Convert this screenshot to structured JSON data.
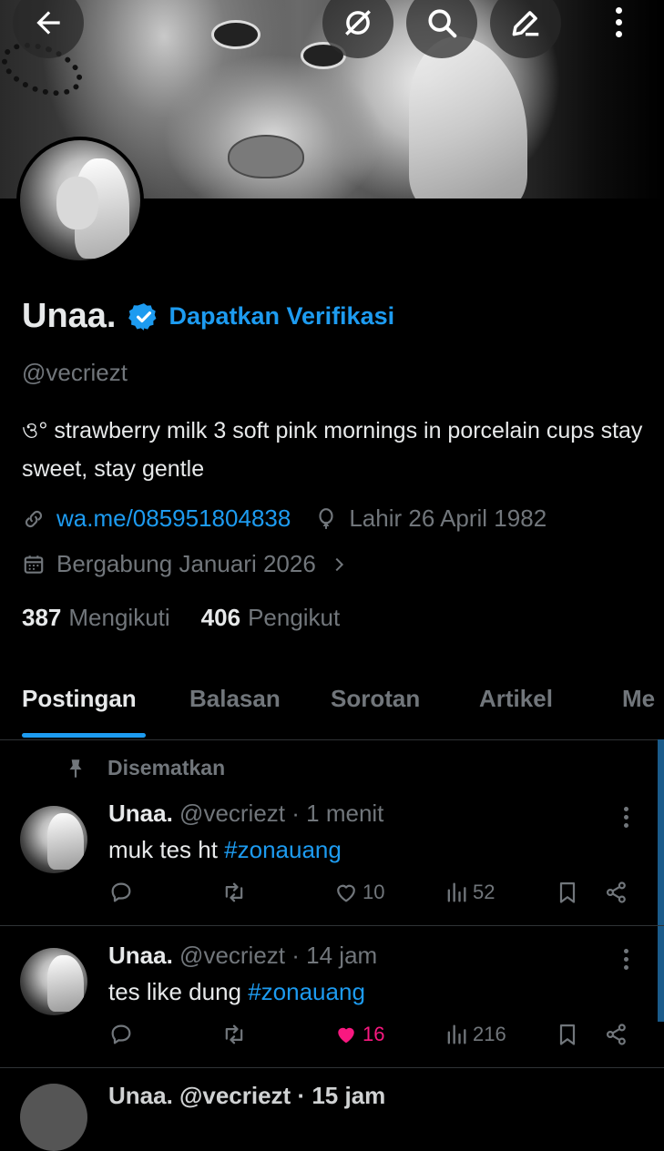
{
  "header": {
    "back_icon": "arrow-left-icon",
    "grok_icon": "grok-icon",
    "search_icon": "search-icon",
    "edit_icon": "edit-icon",
    "more_icon": "more-vertical-icon"
  },
  "profile": {
    "name": "Unaa.",
    "verify_cta": "Dapatkan Verifikasi",
    "handle": "@vecriezt",
    "bio": "ও° strawberry milk 3 soft pink mornings in porcelain cups stay sweet, stay gentle",
    "website": "wa.me/085951804838",
    "birthday": "Lahir 26 April 1982",
    "joined": "Bergabung Januari 2026",
    "following_count": "387",
    "following_label": "Mengikuti",
    "followers_count": "406",
    "followers_label": "Pengikut"
  },
  "tabs": [
    {
      "label": "Postingan",
      "active": true
    },
    {
      "label": "Balasan",
      "active": false
    },
    {
      "label": "Sorotan",
      "active": false
    },
    {
      "label": "Artikel",
      "active": false
    },
    {
      "label": "Me",
      "active": false
    }
  ],
  "pinned_label": "Disematkan",
  "posts": [
    {
      "name": "Unaa.",
      "handle": "@vecriezt",
      "time": "· 1 menit",
      "text": "muk tes ht ",
      "hashtag": "#zonauang",
      "likes": "10",
      "views": "52",
      "liked": false
    },
    {
      "name": "Unaa.",
      "handle": "@vecriezt",
      "time": "· 14 jam",
      "text": "tes like dung ",
      "hashtag": "#zonauang",
      "likes": "16",
      "views": "216",
      "liked": true
    }
  ],
  "partial_post": {
    "text": "Unaa.  @vecriezt · 15 jam"
  },
  "colors": {
    "accent": "#1d9bf0",
    "like": "#f91880",
    "muted": "#71767b",
    "text": "#e7e9ea",
    "background": "#000000"
  }
}
